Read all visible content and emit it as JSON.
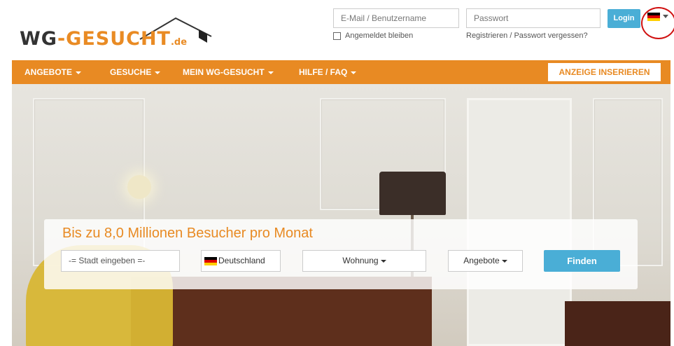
{
  "logo": {
    "wg": "WG",
    "rest": "-GESUCHT",
    "tld": ".de"
  },
  "login": {
    "email_placeholder": "E-Mail / Benutzername",
    "password_placeholder": "Passwort",
    "remember_label": "Angemeldet bleiben",
    "register_link": "Registrieren / Passwort vergessen?",
    "login_button": "Login"
  },
  "nav": {
    "items": [
      {
        "label": "ANGEBOTE"
      },
      {
        "label": "GESUCHE"
      },
      {
        "label": "MEIN WG-GESUCHT"
      },
      {
        "label": "HILFE / FAQ"
      }
    ],
    "insert_button": "ANZEIGE INSERIEREN"
  },
  "search": {
    "headline": "Bis zu 8,0 Millionen Besucher pro Monat",
    "city_placeholder": "-= Stadt eingeben =-",
    "country": "Deutschland",
    "type": "Wohnung",
    "offer": "Angebote",
    "find_button": "Finden"
  },
  "colors": {
    "brand_orange": "#e88a23",
    "button_blue": "#4aaed6",
    "annotation_red": "#d01010"
  },
  "icons": {
    "language_flag": "german-flag-icon",
    "country_flag": "german-flag-icon",
    "logo_roof": "roof-icon"
  }
}
